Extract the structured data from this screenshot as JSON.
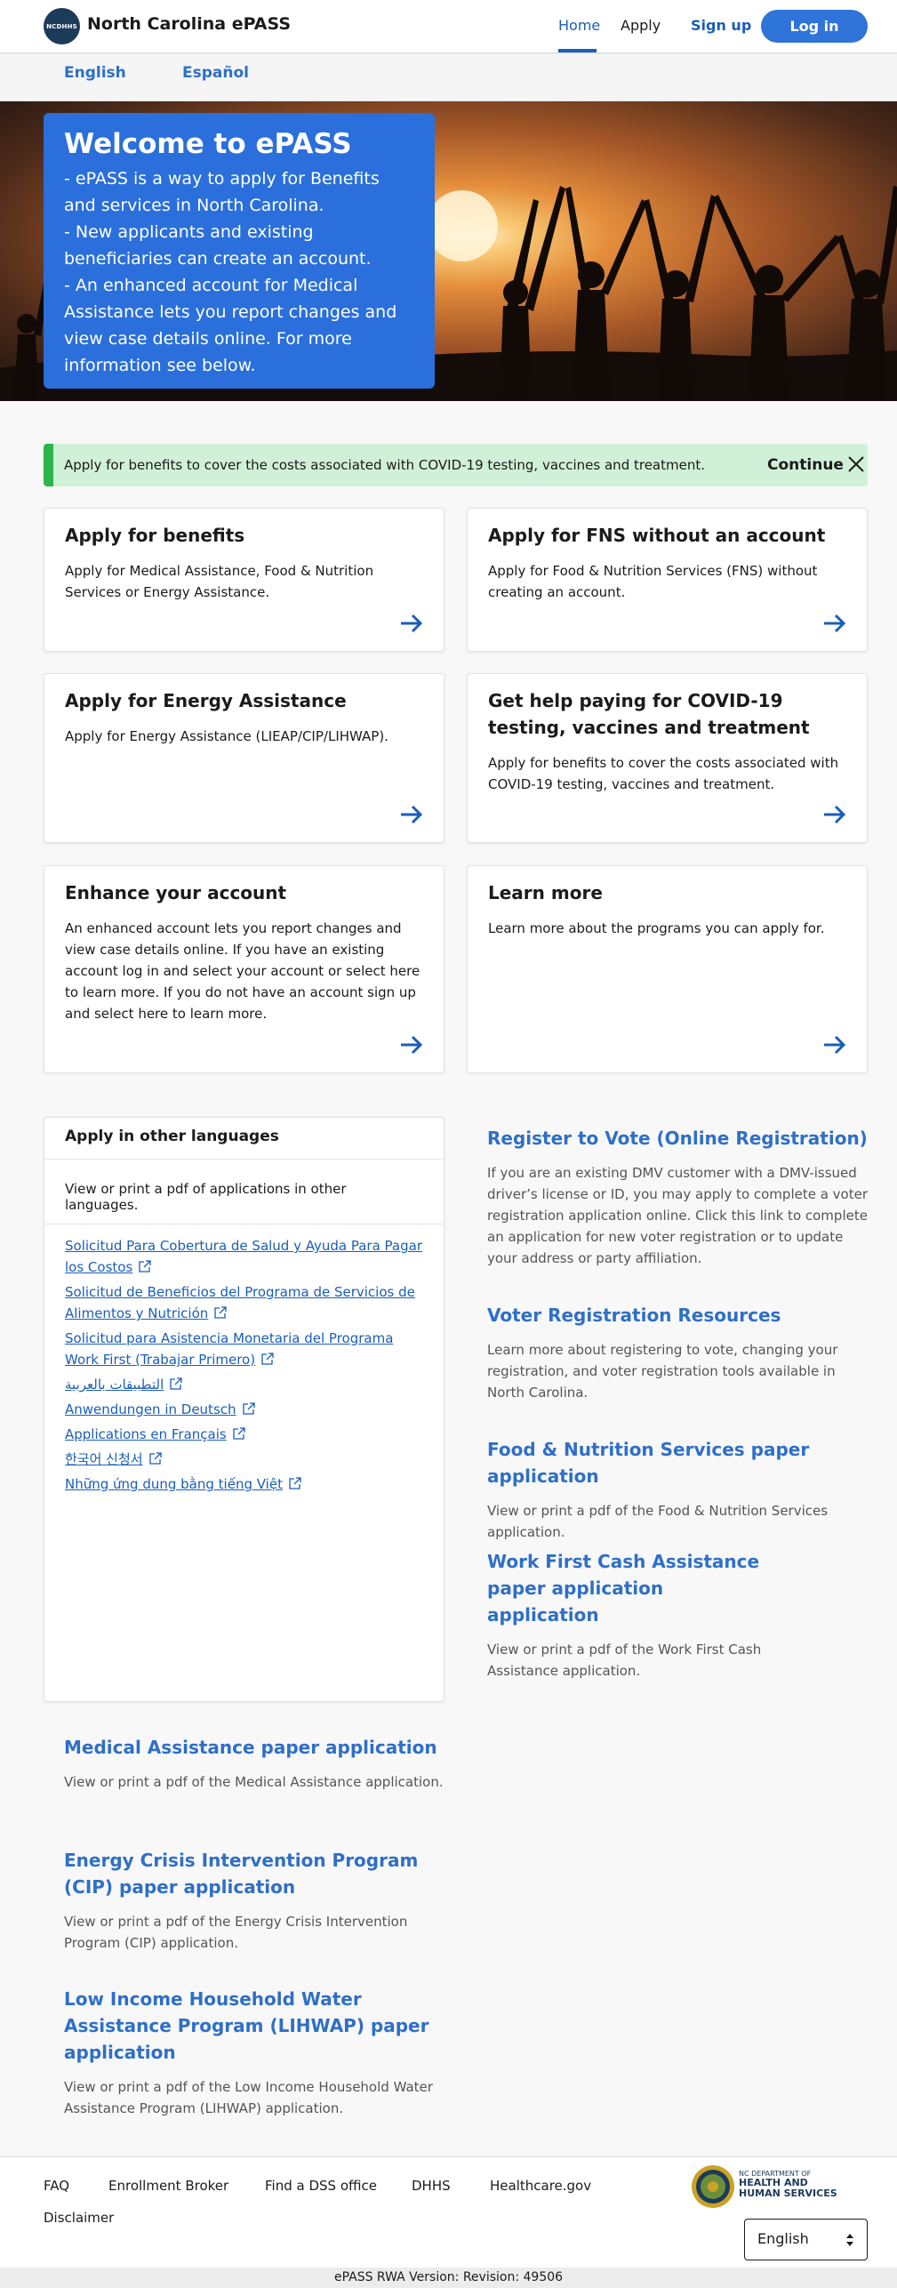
{
  "header": {
    "logo_text": "NCDHHS",
    "brand": "North Carolina ePASS",
    "nav": {
      "home": "Home",
      "apply": "Apply",
      "signup": "Sign up",
      "login": "Log in"
    }
  },
  "languages_bar": {
    "english": "English",
    "spanish": "Español"
  },
  "hero": {
    "title": "Welcome to ePASS",
    "lines": [
      "- ePASS is a way to apply for Benefits and services in North Carolina.",
      "- New applicants and existing beneficiaries can create an account.",
      "- An enhanced account for Medical Assistance lets you report changes and view case details online. For more information see below."
    ]
  },
  "banner": {
    "text": "Apply for benefits to cover the costs associated with COVID-19 testing, vaccines and treatment.",
    "continue": "Continue"
  },
  "cards": [
    {
      "title": "Apply for benefits",
      "desc": "Apply for Medical Assistance, Food & Nutrition Services or Energy Assistance."
    },
    {
      "title": "Apply for FNS without an account",
      "desc": "Apply for Food & Nutrition Services (FNS) without creating an account."
    },
    {
      "title": "Apply for Energy Assistance",
      "desc": "Apply for Energy Assistance (LIEAP/CIP/LIHWAP)."
    },
    {
      "title": "Get help paying for COVID-19 testing, vaccines and treatment",
      "desc": "Apply for benefits to cover the costs associated with COVID-19 testing, vaccines and treatment."
    },
    {
      "title": "Enhance your account",
      "desc": "An enhanced account lets you report changes and view case details online. If you have an existing account log in and select your account or select here to learn more. If you do not have an account sign up and select here to learn more."
    },
    {
      "title": "Learn more",
      "desc": "Learn more about the programs you can apply for."
    }
  ],
  "other_languages": {
    "title": "Apply in other languages",
    "subtitle": "View or print a pdf of applications in other languages.",
    "links": [
      "Solicitud Para Cobertura de Salud y Ayuda Para Pagar los Costos",
      "Solicitud de Beneficios del Programa de Servicios de Alimentos y Nutrición",
      "Solicitud para Asistencia Monetaria del Programa Work First (Trabajar Primero)",
      "التطبيقات بالعربية",
      "Anwendungen in Deutsch",
      "Applications en Français",
      "한국어 신청서",
      "Những ứng dung bằng tiếng Việt"
    ]
  },
  "side_links": [
    {
      "title": "Register to Vote (Online Registration)",
      "desc": "If you are an existing DMV customer with a DMV-issued driver’s license or ID, you may apply to complete a voter registration application online. Click this link to complete an application for new voter registration or to update your address or party affiliation."
    },
    {
      "title": "Voter Registration Resources",
      "desc": "Learn more about registering to vote, changing your registration, and voter registration tools available in North Carolina."
    },
    {
      "title": "Food & Nutrition Services paper application",
      "desc": "View or print a pdf of the Food & Nutrition Services application."
    },
    {
      "title": "Work First Cash Assistance paper application",
      "title_extra": "application",
      "desc": "View or print a pdf of the Work First Cash Assistance application."
    },
    {
      "title": "Medical Assistance paper application",
      "desc": "View or print a pdf of the Medical Assistance application."
    },
    {
      "title": "Energy Crisis Intervention Program (CIP) paper application",
      "desc": "View or print a pdf of the Energy Crisis Intervention Program (CIP) application."
    },
    {
      "title": "Low Income Household Water Assistance Program (LIHWAP) paper application",
      "desc": "View or print a pdf of the Low Income Household Water Assistance Program (LIHWAP) application."
    }
  ],
  "footer": {
    "links": [
      "FAQ",
      "Enrollment Broker",
      "Find a DSS office",
      "DHHS",
      "Healthcare.gov",
      "Disclaimer"
    ],
    "dhhs_small": "NC DEPARTMENT OF",
    "dhhs_big": "HEALTH AND HUMAN SERVICES",
    "language_select": "English",
    "version": "ePASS RWA Version: Revision: 49506"
  },
  "colors": {
    "primary": "#2f74d8",
    "banner_bg": "#d1f0d8",
    "banner_accent": "#2bb54b",
    "link": "#1a5eb8"
  }
}
